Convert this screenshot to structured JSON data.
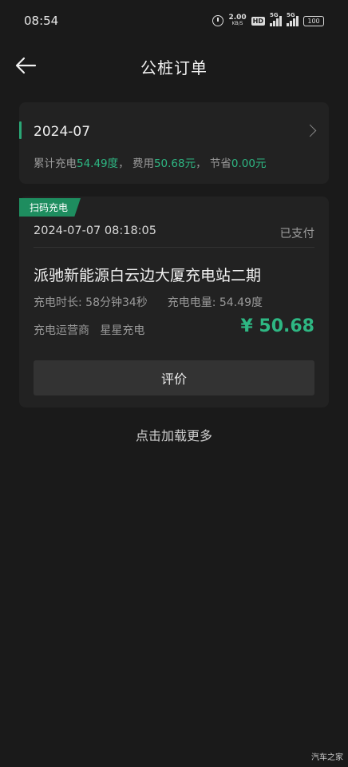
{
  "status_bar": {
    "time": "08:54",
    "net_speed_value": "2.00",
    "net_speed_unit": "KB/S",
    "hd_label": "HD",
    "signal1_tag": "5G",
    "signal2_tag": "5G",
    "battery": "100",
    "icons": [
      "alarm-icon",
      "hd-icon",
      "signal-icon",
      "signal-icon",
      "battery-icon"
    ]
  },
  "header": {
    "title": "公桩订单",
    "back_icon": "arrow-left-icon"
  },
  "month_card": {
    "month": "2024-07",
    "summary_prefix": "累计充电",
    "total_kwh": "54.49度",
    "cost_label": "，  费用",
    "cost": "50.68元",
    "saved_label": "，  节省",
    "saved": "0.00元",
    "chevron_icon": "chevron-right-icon"
  },
  "order": {
    "badge": "扫码充电",
    "time": "2024-07-07 08:18:05",
    "status": "已支付",
    "station": "派驰新能源白云边大厦充电站二期",
    "duration_label": "充电时长:",
    "duration": "58分钟34秒",
    "energy_label": "充电电量:",
    "energy": "54.49度",
    "operator_label": "充电运营商",
    "operator": "星星充电",
    "price": "¥ 50.68",
    "review_button": "评价"
  },
  "load_more": "点击加载更多",
  "watermark": "汽车之家",
  "colors": {
    "background": "#1a1a1a",
    "card": "#222222",
    "accent_green": "#2eb783",
    "badge_green": "#1e8d5f"
  }
}
